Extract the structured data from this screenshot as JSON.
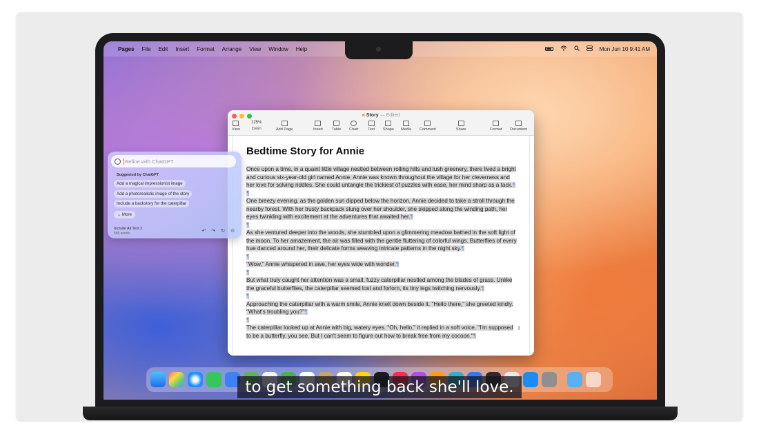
{
  "menubar": {
    "app_name": "Pages",
    "items": [
      "File",
      "Edit",
      "Insert",
      "Format",
      "Arrange",
      "View",
      "Window",
      "Help"
    ],
    "datetime": "Mon Jun 10  9:41 AM"
  },
  "window": {
    "title": "Story",
    "edited": "— Edited",
    "toolbar": {
      "view": "View",
      "zoom_value": "125%",
      "zoom": "Zoom",
      "add_page": "Add Page",
      "insert": "Insert",
      "table": "Table",
      "chart": "Chart",
      "text": "Text",
      "shape": "Shape",
      "media": "Media",
      "comment": "Comment",
      "share": "Share",
      "format": "Format",
      "document": "Document"
    }
  },
  "document": {
    "title": "Bedtime Story for Annie",
    "paragraphs": [
      "Once upon a time, in a quaint little village nestled between rolling hills and lush greenery, there lived a bright and curious six-year-old girl named Annie. Annie was known throughout the village for her cleverness and her love for solving riddles. She could untangle the trickiest of puzzles with ease, her mind sharp as a tack.",
      "One breezy evening, as the golden sun dipped below the horizon, Annie decided to take a stroll through the nearby forest. With her trusty backpack slung over her shoulder, she skipped along the winding path, her eyes twinkling with excitement at the adventures that awaited her.",
      "As she ventured deeper into the woods, she stumbled upon a glimmering meadow bathed in the soft light of the moon. To her amazement, the air was filled with the gentle fluttering of colorful wings. Butterflies of every hue danced around her, their delicate forms weaving intricate patterns in the night sky.",
      "\"Wow,\" Annie whispered in awe, her eyes wide with wonder.",
      "But what truly caught her attention was a small, fuzzy caterpillar nestled among the blades of grass. Unlike the graceful butterflies, the caterpillar seemed lost and forlorn, its tiny legs twitching nervously.",
      "Approaching the caterpillar with a warm smile, Annie knelt down beside it. \"Hello there,\" she greeted kindly. \"What's troubling you?\"",
      "The caterpillar looked up at Annie with big, watery eyes. \"Oh, hello,\" it replied in a soft voice. \"I'm supposed to be a butterfly, you see. But I can't seem to figure out how to break free from my cocoon.\""
    ],
    "pilcrow": "¶"
  },
  "chatgpt": {
    "placeholder": "Refine with ChatGPT",
    "suggested_header": "Suggested by ChatGPT",
    "suggestions": [
      "Add a magical impressionist image",
      "Add a photorealistic image of the story",
      "Include a backstory for the caterpillar"
    ],
    "more": "More",
    "include_label": "Include All Text 2",
    "word_count": "585 words"
  },
  "subtitle": "to get something back she'll love.",
  "colors": {
    "selection": "#d9d9d9",
    "pilcrow": "#5b8fd6",
    "caret": "#e8742b"
  }
}
